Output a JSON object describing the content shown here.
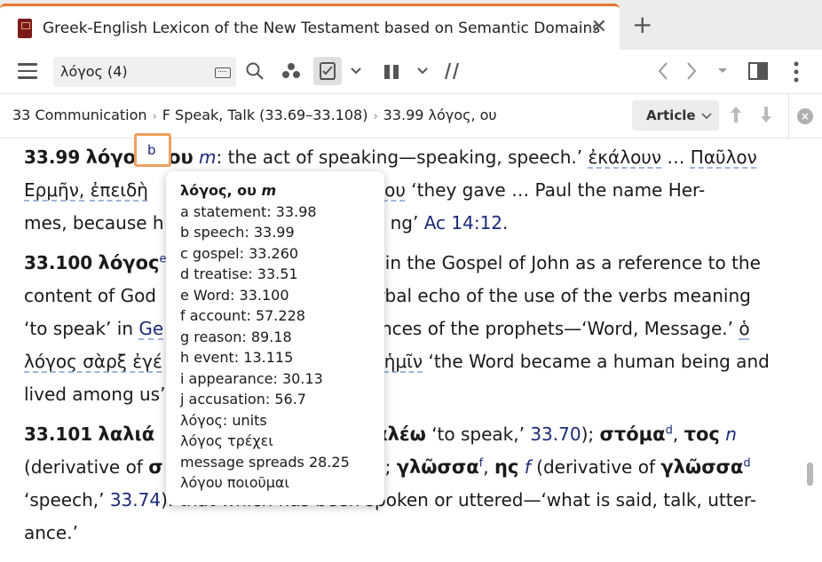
{
  "tab": {
    "title": "Greek-English Lexicon of the New Testament based on Semantic Domains",
    "close": "✕",
    "new": "+"
  },
  "toolbar": {
    "search_value": "λόγος (4)",
    "icons": [
      "menu-icon",
      "keyboard-icon",
      "search-icon",
      "cluster-icon",
      "notes-icon",
      "chevron-down-icon",
      "columns-icon",
      "chevron-down-icon",
      "parallel-icon",
      "back-icon",
      "forward-icon",
      "dropdown-icon",
      "panel-icon",
      "more-icon"
    ]
  },
  "breadcrumb": {
    "items": [
      "33 Communication",
      "F Speak, Talk (33.69–33.108)",
      "33.99 λόγος, ου"
    ],
    "sep": "›"
  },
  "article_button": {
    "label": "Article"
  },
  "entries": {
    "e1": {
      "num": "33.99",
      "head_a": "λόγο",
      "head_b": "ου",
      "gender": "m",
      "t1": ": the act of speaking—speaking, speech.’",
      "g1": "ἐκάλουν",
      "t2": " … ",
      "g2": "Παῦλον",
      "g3": "Ερμῆν,",
      "g4": "ἐπειδὴ",
      "g5": "τοῦ λόγου",
      "t3": " ‘they gave … Paul the name Her-",
      "t4": "mes, because h",
      "t5": "ng’ ",
      "ref": "Ac 14:12",
      "t6": "."
    },
    "e2": {
      "num": "33.100",
      "head": "λόγος",
      "sup": "e",
      "t1": " in the Gospel of John as a reference to the",
      "t2": "content of God",
      "t3": "erbal echo of the use of the verbs meaning",
      "t4": "‘to speak’ in ",
      "l1": "Ge",
      "t5": "erances of the prophets—‘Word, Message.’ ",
      "g1": "ὁ",
      "g2": "λόγος σὰρξ ἐγέ",
      "g3": "ἡμῖν",
      "t6": " ‘the Word became a human being and",
      "t7": "lived among us’"
    },
    "e3": {
      "num": "33.101",
      "head": "λαλιά",
      "h2": "αλέω",
      "t1": " ‘to speak,’ ",
      "ref1": "33.70",
      "t2": "); ",
      "h3": "στόμα",
      "sup1": "d",
      "t3": ", ",
      "h4": "τος",
      "gender1": "n",
      "t4": "(derivative of ",
      "h5": "σ",
      "t5": "; ",
      "h6": "γλῶσσα",
      "sup2": "f",
      "t6": ", ",
      "h7": "ης",
      "gender2": "f",
      "t7": " (derivative of ",
      "h8": "γλῶσσα",
      "sup3": "d",
      "t8": "‘speech,’ ",
      "ref2": "33.74",
      "t9": "): that which has been spoken or uttered—‘what is said, talk, utter-",
      "t10": "ance.’"
    }
  },
  "popup": {
    "highlight_letter": "b",
    "heading": "λόγος, ου",
    "heading_gender": "m",
    "lines": [
      "a statement: 33.98",
      "b speech: 33.99",
      "c gospel: 33.260",
      "d treatise: 33.51",
      "e Word: 33.100",
      "f account: 57.228",
      "g reason: 89.18",
      "h event: 13.115",
      "i appearance: 30.13",
      "j accusation: 56.7",
      "λόγος: units",
      "λόγος τρέχει",
      "message spreads 28.25",
      "λόγου ποιοῦμαι"
    ]
  }
}
